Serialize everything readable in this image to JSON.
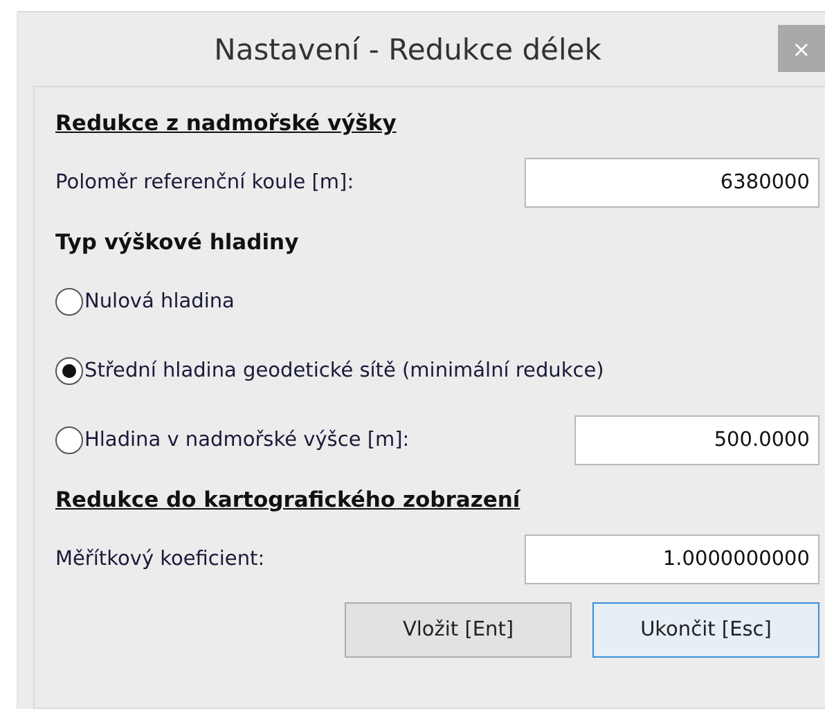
{
  "window": {
    "title": "Nastavení - Redukce délek",
    "close": "×"
  },
  "items": [
    {
      "kind": "heading",
      "label": "Redukce z nadmořské výšky",
      "underline": true
    },
    {
      "kind": "field",
      "label": "Poloměr referenční koule [m]:",
      "value": "6380000"
    },
    {
      "kind": "heading",
      "label": "Typ výškové hladiny",
      "underline": false
    },
    {
      "kind": "radio",
      "label": "Nulová hladina",
      "selected": false
    },
    {
      "kind": "radio",
      "label": "Střední hladina geodetické sítě (minimální redukce)",
      "selected": true
    },
    {
      "kind": "radio",
      "label": "Hladina v nadmořské výšce [m]:",
      "selected": false,
      "value": "500.0000"
    },
    {
      "kind": "heading",
      "label": "Redukce do kartografického zobrazení",
      "underline": true
    },
    {
      "kind": "field",
      "label": "Měřítkový koeficient:",
      "value": "1.0000000000"
    }
  ],
  "buttons": [
    {
      "label": "Vložit [Ent]",
      "focused": false
    },
    {
      "label": "Ukončit [Esc]",
      "focused": true
    }
  ]
}
